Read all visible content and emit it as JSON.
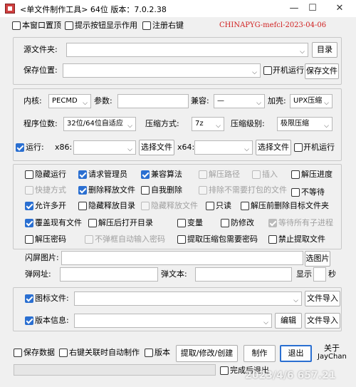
{
  "window": {
    "title": "<单文件制作工具> 64位 版本：7.0.2.38",
    "minimize": "—",
    "maximize": "☐",
    "close": "✕"
  },
  "top_options": {
    "window_topmost": "本窗口置顶",
    "tooltip_hint": "提示按钮显示作用",
    "register_context": "注册右键",
    "credit": "CHINAPYG-mefcl-2023-04-06"
  },
  "source": {
    "folder_label": "源文件夹:",
    "folder_value": "",
    "dir_button": "目录",
    "save_label": "保存位置:",
    "save_value": "",
    "startup_label": "开机运行",
    "save_file_button": "保存文件"
  },
  "core": {
    "kernel_label": "内核:",
    "kernel_value": "PECMD",
    "param_label": "参数:",
    "param_value": "",
    "compat_label": "兼容:",
    "compat_value": "—",
    "shell_label": "加壳:",
    "shell_value": "UPX压缩",
    "bits_label": "程序位数:",
    "bits_value": "32位/64位自适应",
    "compress_label": "压缩方式:",
    "compress_value": "7z",
    "level_label": "压缩级别:",
    "level_value": "极限压缩",
    "run_label": "运行:",
    "x86_label": "x86:",
    "x86_value": "",
    "select_file_1": "选择文件",
    "x64_label": "x64:",
    "x64_value": "",
    "select_file_2": "选择文件",
    "startup_label": "开机运行"
  },
  "options": {
    "hidden_run": "隐藏运行",
    "request_admin": "请求管理员",
    "compat_algo": "兼容算法",
    "unzip_path": "解压路径",
    "insert": "插入",
    "unzip_progress": "解压进度",
    "shortcut": "快捷方式",
    "delete_release": "删除释放文件",
    "self_delete": "自我删除",
    "exclude_files": "排除不需要打包的文件",
    "no_wait": "不等待",
    "allow_multi": "允许多开",
    "hide_release_dir": "隐藏释放目录",
    "hide_release_files": "隐藏释放文件",
    "readonly": "只读",
    "delete_target_before": "解压前删除目标文件夹",
    "overwrite_existing": "覆盖现有文件",
    "open_dir_after": "解压后打开目录",
    "variable": "变量",
    "anti_tamper": "防修改",
    "wait_child": "等待所有子进程",
    "unzip_password": "解压密码",
    "no_autoinput_popup": "不弹框自动输入密码",
    "extract_password": "提取压缩包需要密码",
    "forbid_extract": "禁止提取文件"
  },
  "splash": {
    "image_label": "闪屏图片:",
    "image_value": "",
    "select_image_button": "选图片",
    "url_label": "弹网址:",
    "url_value": "",
    "text_label": "弹文本:",
    "text_value": "",
    "show_label": "显示",
    "seconds_value": "",
    "seconds_label": "秒"
  },
  "resources": {
    "icon_label": "图标文件:",
    "icon_value": "",
    "icon_import": "文件导入",
    "version_label": "版本信息:",
    "version_value": "",
    "edit_button": "编辑",
    "version_import": "文件导入"
  },
  "bottom": {
    "save_data": "保存数据",
    "context_auto": "右键关联时自动制作",
    "version": "版本",
    "extract_button": "提取/修改/创建",
    "make_button": "制作",
    "exit_button": "退出",
    "about_line1": "关于",
    "about_line2": "JayChan",
    "shutdown_after": "完成后退出",
    "progress": 0
  },
  "overlay": {
    "watermark": "2023/4/6 657.21"
  },
  "colors": {
    "accent": "#2a6fd1",
    "credit": "#d02020",
    "background": "#f0f0f0"
  }
}
